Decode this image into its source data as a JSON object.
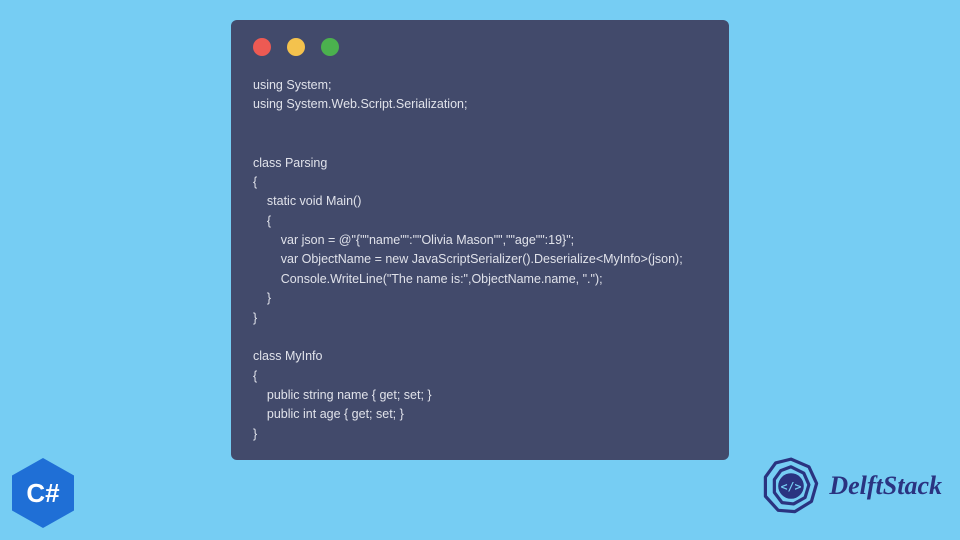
{
  "window": {
    "traffic": {
      "red": "#ed5a53",
      "yellow": "#f4c24d",
      "green": "#4bb14e"
    }
  },
  "code": {
    "lines": [
      "using System;",
      "using System.Web.Script.Serialization;",
      "",
      "",
      "class Parsing",
      "{",
      "    static void Main()",
      "    {",
      "        var json = @\"{\"\"name\"\":\"\"Olivia Mason\"\",\"\"age\"\":19}\";",
      "        var ObjectName = new JavaScriptSerializer().Deserialize<MyInfo>(json);",
      "        Console.WriteLine(\"The name is:\",ObjectName.name, \".\");",
      "    }",
      "}",
      "",
      "class MyInfo",
      "{",
      "    public string name { get; set; }",
      "    public int age { get; set; }",
      "}"
    ]
  },
  "logos": {
    "csharp_label": "C#",
    "delftstack_label": "DelftStack"
  },
  "colors": {
    "page_bg": "#76cdf3",
    "window_bg": "#424a6b",
    "code_text": "#e0e2ea",
    "hex_bg": "#1f6fd6",
    "ds_text": "#2a3380"
  }
}
